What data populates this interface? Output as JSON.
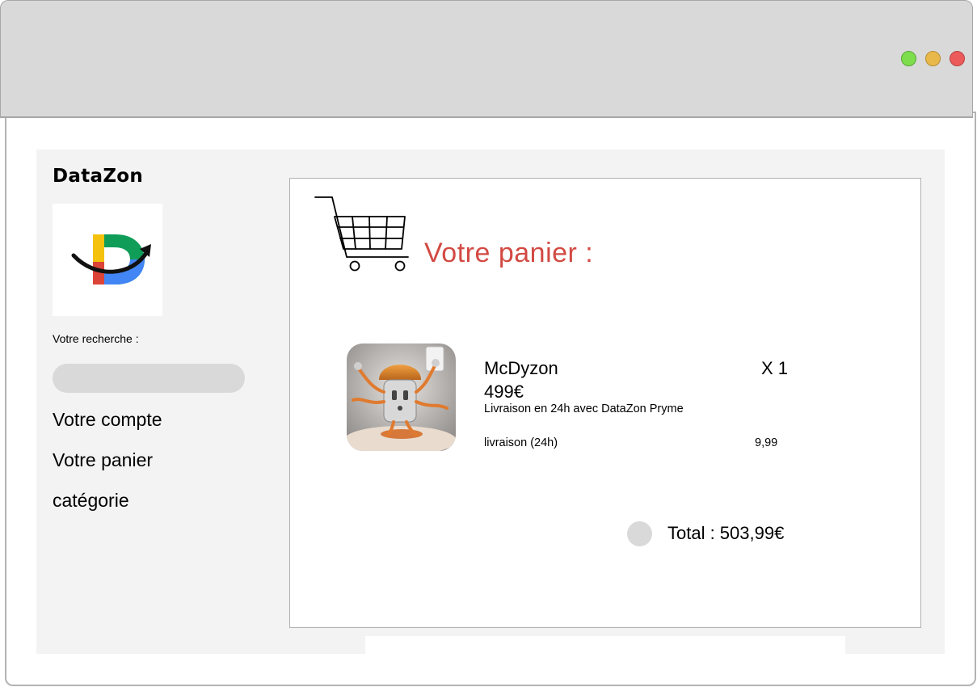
{
  "window": {
    "buttons": {
      "maximize_color": "#7ddd4d",
      "minimize_color": "#e8b84a",
      "close_color": "#ec5a5a"
    }
  },
  "sidebar": {
    "brand": "DataZon",
    "logo_icon": "datazon-logo",
    "search_label": "Votre recherche :",
    "search_value": "",
    "nav": [
      {
        "label": "Votre compte"
      },
      {
        "label": "Votre panier"
      },
      {
        "label": "catégorie"
      }
    ]
  },
  "cart": {
    "icon": "shopping-cart-icon",
    "title": "Votre panier :",
    "title_color": "#d24a43",
    "item": {
      "name": "McDyzon",
      "quantity": "X 1",
      "price": "499€",
      "description": "Livraison en 24h avec DataZon Pryme",
      "delivery_label": "livraison (24h)",
      "delivery_price": "9,99"
    },
    "total": "Total : 503,99€"
  }
}
